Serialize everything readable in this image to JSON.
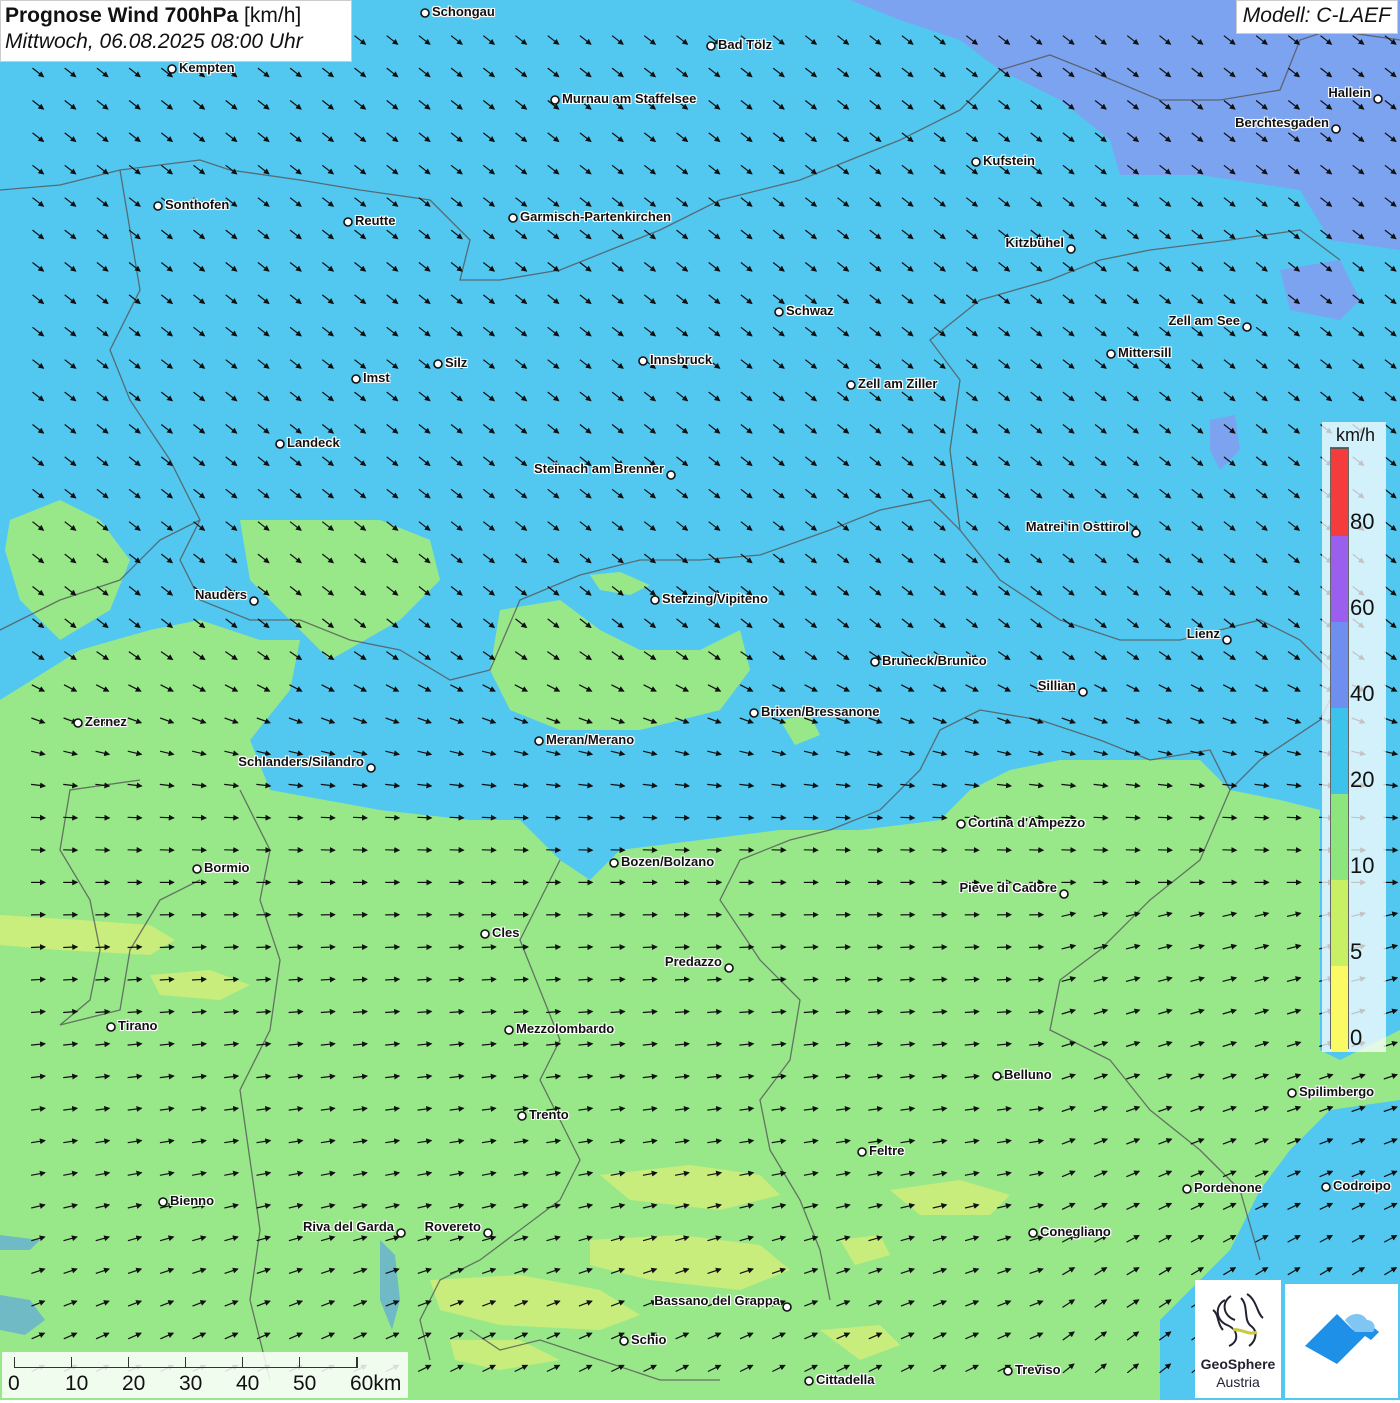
{
  "title": {
    "main_bold": "Prognose Wind 700hPa",
    "unit": "[km/h]",
    "datetime": "Mittwoch, 06.08.2025 08:00 Uhr"
  },
  "model": "Modell: C-LAEF",
  "legend": {
    "unit": "km/h",
    "bands": [
      {
        "label": "0",
        "color": "#fafa64"
      },
      {
        "label": "5",
        "color": "#c8f064"
      },
      {
        "label": "10",
        "color": "#8ce67d"
      },
      {
        "label": "20",
        "color": "#3cc3eb"
      },
      {
        "label": "40",
        "color": "#6e8ef0"
      },
      {
        "label": "60",
        "color": "#9b5ff0"
      },
      {
        "label": "80",
        "color": "#f53c3c"
      }
    ]
  },
  "scale_bar": {
    "labels": [
      "0",
      "10",
      "20",
      "30",
      "40",
      "50",
      "60km"
    ]
  },
  "logo": {
    "name_line1": "GeoSphere",
    "name_line2": "Austria"
  },
  "cities": [
    {
      "name": "Schongau",
      "side": "right"
    },
    {
      "name": "Bad Tölz",
      "side": "right"
    },
    {
      "name": "Kempten",
      "side": "right"
    },
    {
      "name": "Murnau am Staffelsee",
      "side": "right"
    },
    {
      "name": "Hallein",
      "side": "left"
    },
    {
      "name": "Berchtesgaden",
      "side": "left"
    },
    {
      "name": "Kufstein",
      "side": "right"
    },
    {
      "name": "Sonthofen",
      "side": "right"
    },
    {
      "name": "Reutte",
      "side": "right"
    },
    {
      "name": "Garmisch-Partenkirchen",
      "side": "right"
    },
    {
      "name": "Kitzbühel",
      "side": "left"
    },
    {
      "name": "Schwaz",
      "side": "right"
    },
    {
      "name": "Zell am See",
      "side": "left"
    },
    {
      "name": "Innsbruck",
      "side": "right"
    },
    {
      "name": "Mittersill",
      "side": "right"
    },
    {
      "name": "Silz",
      "side": "right"
    },
    {
      "name": "Imst",
      "side": "right"
    },
    {
      "name": "Zell am Ziller",
      "side": "right"
    },
    {
      "name": "Landeck",
      "side": "right"
    },
    {
      "name": "Steinach am Brenner",
      "side": "left"
    },
    {
      "name": "Matrei in Osttirol",
      "side": "left"
    },
    {
      "name": "Nauders",
      "side": "left"
    },
    {
      "name": "Sterzing/Vipiteno",
      "side": "right"
    },
    {
      "name": "Lienz",
      "side": "left"
    },
    {
      "name": "Bruneck/Brunico",
      "side": "right"
    },
    {
      "name": "Sillian",
      "side": "left"
    },
    {
      "name": "Brixen/Bressanone",
      "side": "right"
    },
    {
      "name": "Zernez",
      "side": "right"
    },
    {
      "name": "Meran/Merano",
      "side": "right"
    },
    {
      "name": "Schlanders/Silandro",
      "side": "left"
    },
    {
      "name": "Cortina d'Ampezzo",
      "side": "right"
    },
    {
      "name": "Bozen/Bolzano",
      "side": "right"
    },
    {
      "name": "Bormio",
      "side": "right"
    },
    {
      "name": "Pieve di Cadore",
      "side": "left"
    },
    {
      "name": "Cles",
      "side": "right"
    },
    {
      "name": "Predazzo",
      "side": "left"
    },
    {
      "name": "Tirano",
      "side": "right"
    },
    {
      "name": "Mezzolombardo",
      "side": "right"
    },
    {
      "name": "Belluno",
      "side": "right"
    },
    {
      "name": "Spilimbergo",
      "side": "right"
    },
    {
      "name": "Trento",
      "side": "right"
    },
    {
      "name": "Feltre",
      "side": "right"
    },
    {
      "name": "Pordenone",
      "side": "right"
    },
    {
      "name": "Codroipo",
      "side": "right"
    },
    {
      "name": "Bienno",
      "side": "right"
    },
    {
      "name": "Riva del Garda",
      "side": "left"
    },
    {
      "name": "Rovereto",
      "side": "left"
    },
    {
      "name": "Conegliano",
      "side": "right"
    },
    {
      "name": "Bassano del Grappa",
      "side": "left"
    },
    {
      "name": "Schio",
      "side": "right"
    },
    {
      "name": "Treviso",
      "side": "right"
    },
    {
      "name": "Cittadella",
      "side": "right"
    }
  ]
}
